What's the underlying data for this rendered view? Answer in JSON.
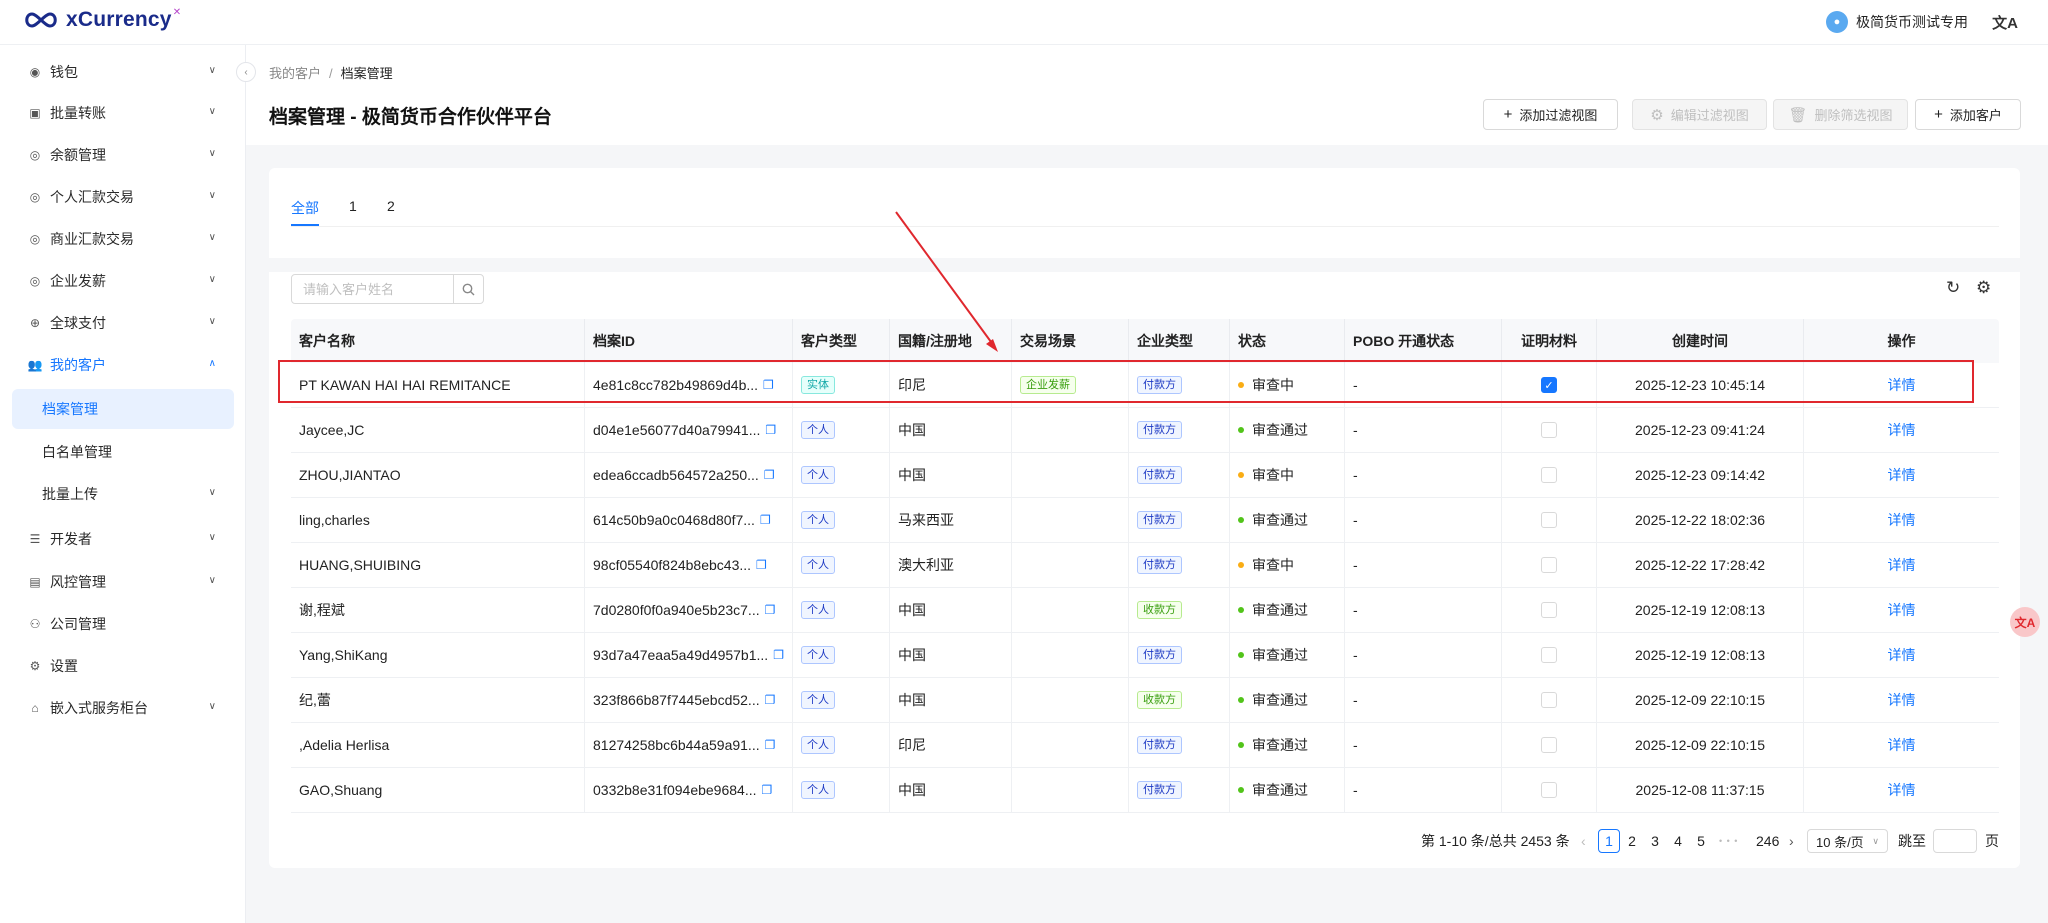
{
  "app": {
    "brand": "xCurrency",
    "user_name": "极简货币测试专用"
  },
  "sidebar": {
    "items": [
      {
        "label": "钱包",
        "icon": "wallet-icon"
      },
      {
        "label": "批量转账",
        "icon": "batch-transfer-icon"
      },
      {
        "label": "余额管理",
        "icon": "balance-icon"
      },
      {
        "label": "个人汇款交易",
        "icon": "personal-remit-icon"
      },
      {
        "label": "商业汇款交易",
        "icon": "business-remit-icon"
      },
      {
        "label": "企业发薪",
        "icon": "payroll-icon"
      },
      {
        "label": "全球支付",
        "icon": "global-pay-icon"
      },
      {
        "label": "我的客户",
        "icon": "customers-icon"
      }
    ],
    "sub_items": [
      "档案管理",
      "白名单管理",
      "批量上传"
    ],
    "items_after": [
      {
        "label": "开发者",
        "icon": "developer-icon"
      },
      {
        "label": "风控管理",
        "icon": "risk-icon"
      },
      {
        "label": "公司管理",
        "icon": "company-icon"
      },
      {
        "label": "设置",
        "icon": "settings-icon"
      },
      {
        "label": "嵌入式服务柜台",
        "icon": "embedded-icon"
      }
    ]
  },
  "breadcrumb": {
    "parent": "我的客户",
    "sep": "/",
    "current": "档案管理"
  },
  "page_title": "档案管理 - 极简货币合作伙伴平台",
  "header_buttons": {
    "add_view": "添加过滤视图",
    "edit_view": "编辑过滤视图",
    "delete_view": "删除筛选视图",
    "add_customer": "添加客户"
  },
  "tabs": [
    "全部",
    "1",
    "2"
  ],
  "search": {
    "placeholder": "请输入客户姓名"
  },
  "table": {
    "columns": [
      "客户名称",
      "档案ID",
      "客户类型",
      "国籍/注册地",
      "交易场景",
      "企业类型",
      "状态",
      "POBO 开通状态",
      "证明材料",
      "创建时间",
      "操作"
    ],
    "rows": [
      {
        "name": "PT KAWAN HAI HAI REMITANCE",
        "id": "4e81c8cc782b49869d4b...",
        "type": "实体",
        "type_tone": "cyan",
        "country": "印尼",
        "scene": "企业发薪",
        "etype": "付款方",
        "etype_tone": "blue",
        "status": "审查中",
        "status_tone": "orange",
        "pobo": "-",
        "proof": true,
        "created": "2025-12-23 10:45:14",
        "action": "详情"
      },
      {
        "name": "Jaycee,JC",
        "id": "d04e1e56077d40a79941...",
        "type": "个人",
        "type_tone": "blue",
        "country": "中国",
        "scene": "",
        "etype": "付款方",
        "etype_tone": "blue",
        "status": "审查通过",
        "status_tone": "green",
        "pobo": "-",
        "proof": false,
        "created": "2025-12-23 09:41:24",
        "action": "详情"
      },
      {
        "name": "ZHOU,JIANTAO",
        "id": "edea6ccadb564572a250...",
        "type": "个人",
        "type_tone": "blue",
        "country": "中国",
        "scene": "",
        "etype": "付款方",
        "etype_tone": "blue",
        "status": "审查中",
        "status_tone": "orange",
        "pobo": "-",
        "proof": false,
        "created": "2025-12-23 09:14:42",
        "action": "详情"
      },
      {
        "name": "ling,charles",
        "id": "614c50b9a0c0468d80f7...",
        "type": "个人",
        "type_tone": "blue",
        "country": "马来西亚",
        "scene": "",
        "etype": "付款方",
        "etype_tone": "blue",
        "status": "审查通过",
        "status_tone": "green",
        "pobo": "-",
        "proof": false,
        "created": "2025-12-22 18:02:36",
        "action": "详情"
      },
      {
        "name": "HUANG,SHUIBING",
        "id": "98cf05540f824b8ebc43...",
        "type": "个人",
        "type_tone": "blue",
        "country": "澳大利亚",
        "scene": "",
        "etype": "付款方",
        "etype_tone": "blue",
        "status": "审查中",
        "status_tone": "orange",
        "pobo": "-",
        "proof": false,
        "created": "2025-12-22 17:28:42",
        "action": "详情"
      },
      {
        "name": "谢,程斌",
        "id": "7d0280f0f0a940e5b23c7...",
        "type": "个人",
        "type_tone": "blue",
        "country": "中国",
        "scene": "",
        "etype": "收款方",
        "etype_tone": "green",
        "status": "审查通过",
        "status_tone": "green",
        "pobo": "-",
        "proof": false,
        "created": "2025-12-19 12:08:13",
        "action": "详情"
      },
      {
        "name": "Yang,ShiKang",
        "id": "93d7a47eaa5a49d4957b1...",
        "type": "个人",
        "type_tone": "blue",
        "country": "中国",
        "scene": "",
        "etype": "付款方",
        "etype_tone": "blue",
        "status": "审查通过",
        "status_tone": "green",
        "pobo": "-",
        "proof": false,
        "created": "2025-12-19 12:08:13",
        "action": "详情"
      },
      {
        "name": "纪,蕾",
        "id": "323f866b87f7445ebcd52...",
        "type": "个人",
        "type_tone": "blue",
        "country": "中国",
        "scene": "",
        "etype": "收款方",
        "etype_tone": "green",
        "status": "审查通过",
        "status_tone": "green",
        "pobo": "-",
        "proof": false,
        "created": "2025-12-09 22:10:15",
        "action": "详情"
      },
      {
        "name": ",Adelia Herlisa",
        "id": "81274258bc6b44a59a91...",
        "type": "个人",
        "type_tone": "blue",
        "country": "印尼",
        "scene": "",
        "etype": "付款方",
        "etype_tone": "blue",
        "status": "审查通过",
        "status_tone": "green",
        "pobo": "-",
        "proof": false,
        "created": "2025-12-09 22:10:15",
        "action": "详情"
      },
      {
        "name": "GAO,Shuang",
        "id": "0332b8e31f094ebe9684...",
        "type": "个人",
        "type_tone": "blue",
        "country": "中国",
        "scene": "",
        "etype": "付款方",
        "etype_tone": "blue",
        "status": "审查通过",
        "status_tone": "green",
        "pobo": "-",
        "proof": false,
        "created": "2025-12-08 11:37:15",
        "action": "详情"
      }
    ]
  },
  "pagination": {
    "summary": "第 1-10 条/总共 2453 条",
    "pages": [
      "1",
      "2",
      "3",
      "4",
      "5"
    ],
    "ellipsis": "• • •",
    "last_page": "246",
    "current": "1",
    "page_size": "10 条/页",
    "jump_label": "跳至",
    "page_suffix": "页"
  },
  "colors": {
    "accent": "#1677ff",
    "annotation": "#e0282e"
  }
}
